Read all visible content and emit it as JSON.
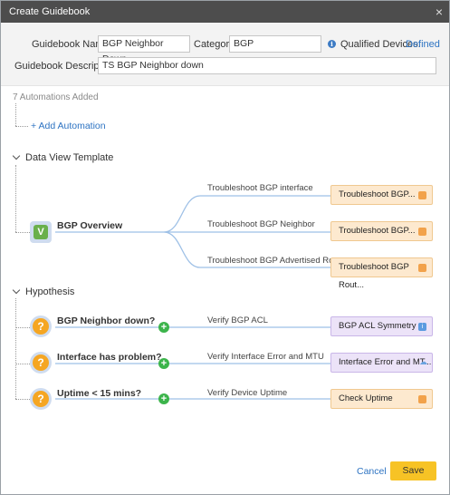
{
  "window": {
    "title": "Create Guidebook",
    "close_label": "×"
  },
  "form": {
    "name_label": "Guidebook Name:",
    "name_value": "BGP Neighbor Down",
    "category_label": "Category:",
    "category_value": "BGP",
    "qualified_label": "Qualified Devices:",
    "qualified_link": "Defined",
    "description_label": "Guidebook Description:",
    "description_value": "TS BGP Neighbor down"
  },
  "automations": {
    "count_text": "7 Automations Added",
    "add_label": "+ Add Automation"
  },
  "data_view": {
    "title": "Data View Template",
    "root_icon": "V",
    "root_label": "BGP Overview",
    "branches": [
      {
        "edge": "Troubleshoot BGP interface",
        "card": "Troubleshoot BGP..."
      },
      {
        "edge": "Troubleshoot BGP Neighbor",
        "card": "Troubleshoot BGP..."
      },
      {
        "edge": "Troubleshoot BGP Advertised Route",
        "card": "Troubleshoot BGP Rout..."
      }
    ]
  },
  "hypothesis": {
    "title": "Hypothesis",
    "items": [
      {
        "label": "BGP Neighbor down?",
        "edge": "Verify BGP ACL",
        "card": "BGP ACL Symmetry",
        "card_color": "purple",
        "badge": "info-icon"
      },
      {
        "label": "Interface has problem?",
        "edge": "Verify Interface Error and MTU",
        "card": "Interface Error and MT...",
        "card_color": "purple",
        "badge": "cloud-icon"
      },
      {
        "label": "Uptime < 15 mins?",
        "edge": "Verify Device Uptime",
        "card": "Check Uptime",
        "card_color": "orange",
        "badge": "runbook-icon"
      }
    ]
  },
  "footer": {
    "cancel_label": "Cancel",
    "save_label": "Save"
  },
  "colors": {
    "accent": "#f7c325",
    "link": "#2d73c2",
    "orange_card": "#fde9cf",
    "purple_card": "#ece3f8",
    "plus": "#3cb44b"
  }
}
